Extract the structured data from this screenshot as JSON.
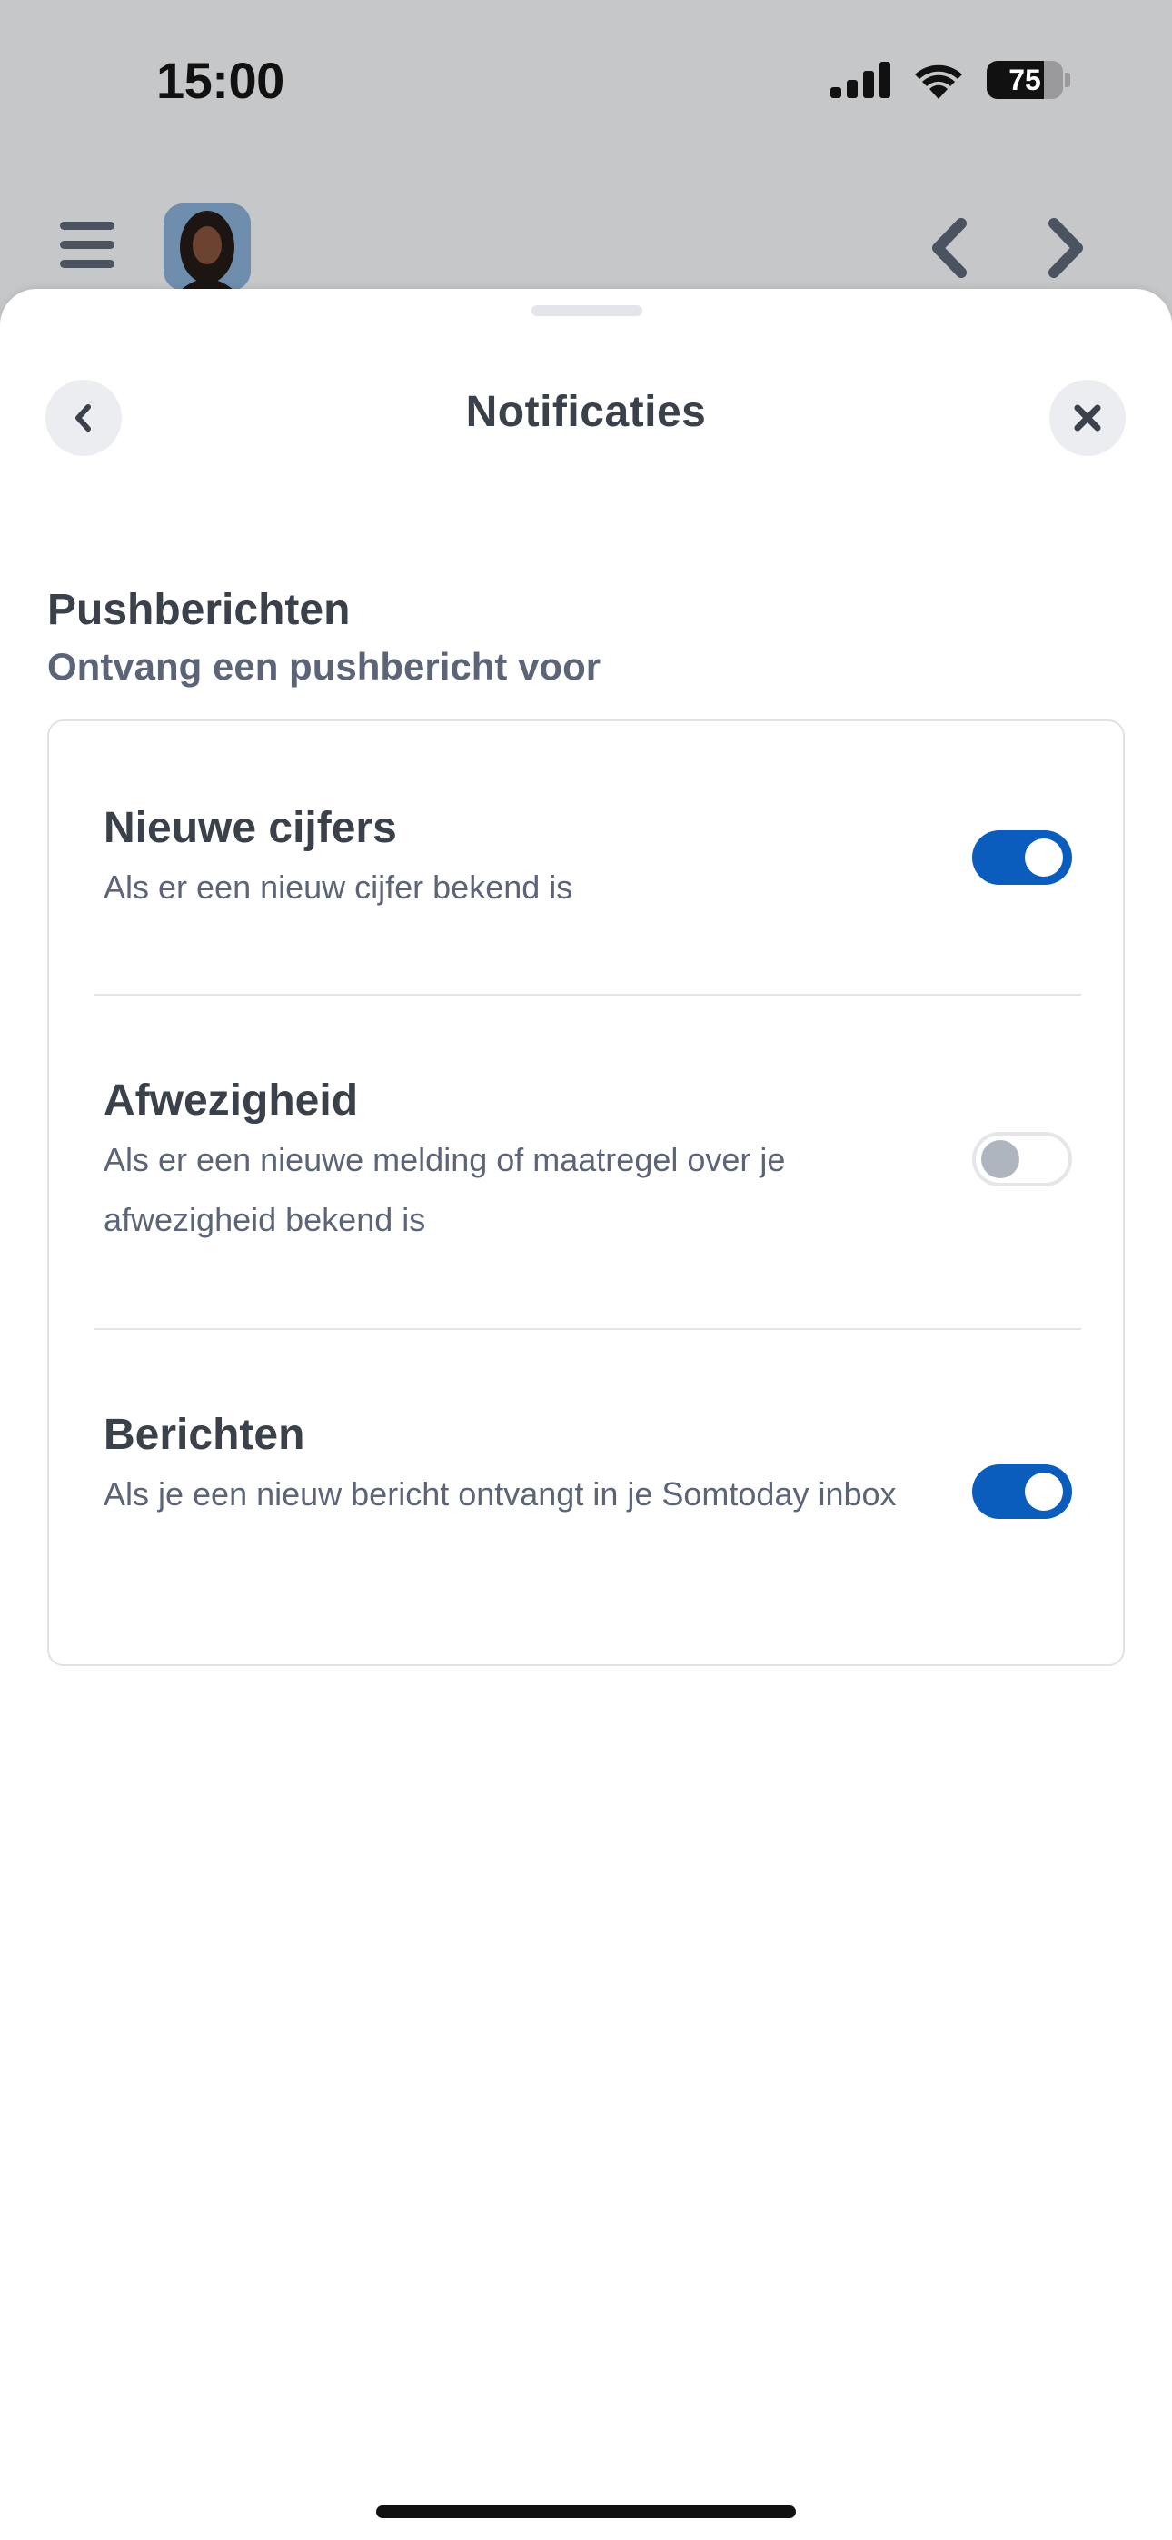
{
  "status_bar": {
    "time": "15:00",
    "battery_percent": "75",
    "battery_level": 0.75,
    "icons": [
      "signal-icon",
      "wifi-icon",
      "battery-icon"
    ]
  },
  "app_bar": {
    "icons": [
      "menu-icon",
      "avatar",
      "chevron-left-icon",
      "chevron-right-icon"
    ]
  },
  "sheet": {
    "title": "Notificaties",
    "back_icon": "chevron-left-icon",
    "close_icon": "close-icon"
  },
  "section": {
    "title": "Pushberichten",
    "subtitle": "Ontvang een pushbericht voor"
  },
  "settings": [
    {
      "title": "Nieuwe cijfers",
      "description": "Als er een nieuw cijfer bekend is",
      "enabled": true
    },
    {
      "title": "Afwezigheid",
      "description": "Als er een nieuwe melding of maatregel over je afwezigheid bekend is",
      "enabled": false
    },
    {
      "title": "Berichten",
      "description": "Als je een nieuw bericht ontvangt in je Somtoday inbox",
      "enabled": true
    }
  ],
  "colors": {
    "accent": "#0a5cbd",
    "text_primary": "#3b414a",
    "text_secondary": "#5b6577",
    "backdrop": "#c6c7c9"
  }
}
